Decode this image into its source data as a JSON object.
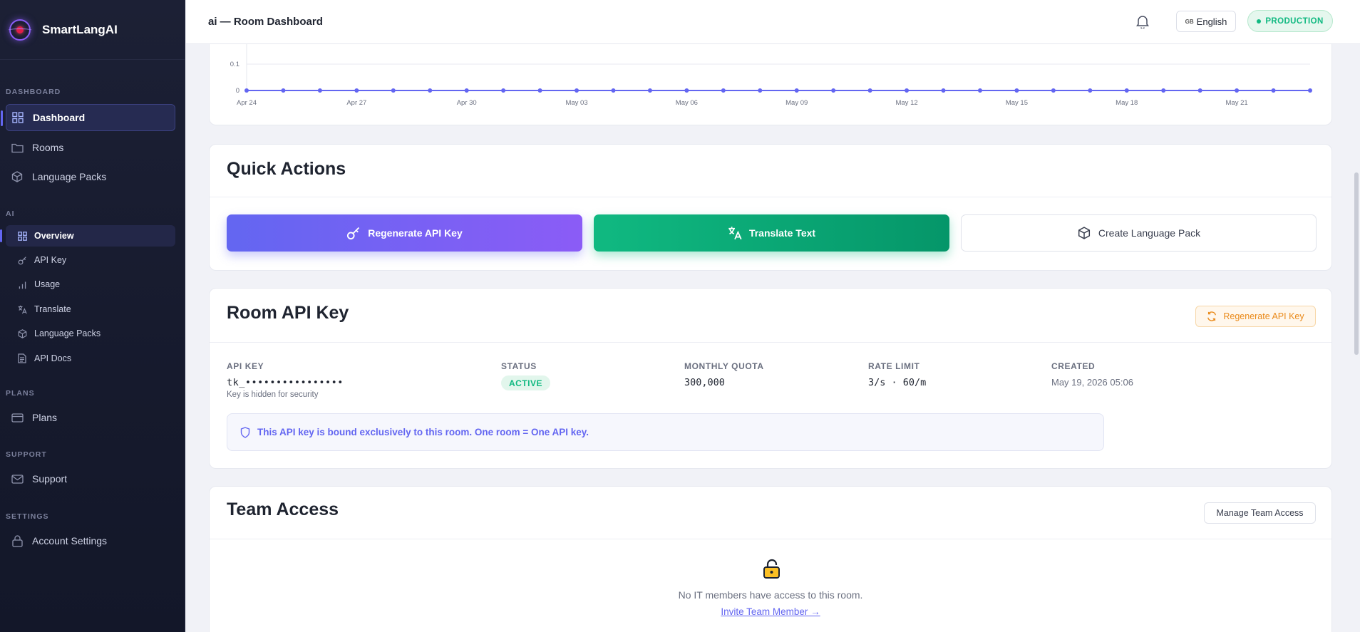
{
  "app": {
    "name": "SmartLangAI"
  },
  "sidebar": {
    "sections": {
      "dashboard": "DASHBOARD",
      "ai": "AI",
      "plans": "PLANS",
      "support": "SUPPORT",
      "settings": "SETTINGS"
    },
    "items": [
      {
        "label": "Dashboard",
        "icon": "grid-icon",
        "active": true
      },
      {
        "label": "Rooms",
        "icon": "folder-icon"
      },
      {
        "label": "Language Packs",
        "icon": "cube-icon"
      },
      {
        "label": "Overview",
        "icon": "grid-icon",
        "active": true
      },
      {
        "label": "API Key",
        "icon": "key-icon"
      },
      {
        "label": "Usage",
        "icon": "bar-chart-icon"
      },
      {
        "label": "Translate",
        "icon": "translate-icon"
      },
      {
        "label": "Language Packs",
        "icon": "cube-icon"
      },
      {
        "label": "API Docs",
        "icon": "document-icon"
      },
      {
        "label": "Plans",
        "icon": "credit-card-icon"
      },
      {
        "label": "Support",
        "icon": "mail-icon"
      },
      {
        "label": "Account Settings",
        "icon": "lock-icon"
      }
    ]
  },
  "topbar": {
    "title": "ai — Room Dashboard",
    "language": {
      "flag": "GB",
      "label": "English"
    },
    "environment": "PRODUCTION"
  },
  "chart_data": {
    "type": "line",
    "x": [
      "Apr 24",
      "Apr 25",
      "Apr 26",
      "Apr 27",
      "Apr 28",
      "Apr 29",
      "Apr 30",
      "May 01",
      "May 02",
      "May 03",
      "May 04",
      "May 05",
      "May 06",
      "May 07",
      "May 08",
      "May 09",
      "May 10",
      "May 11",
      "May 12",
      "May 13",
      "May 14",
      "May 15",
      "May 16",
      "May 17",
      "May 18",
      "May 19",
      "May 20",
      "May 21",
      "May 22",
      "May 23"
    ],
    "x_tick_labels": [
      "Apr 24",
      "Apr 27",
      "Apr 30",
      "May 03",
      "May 06",
      "May 09",
      "May 12",
      "May 15",
      "May 18",
      "May 21"
    ],
    "y_tick_labels": [
      "0.1",
      "0"
    ],
    "series": [
      {
        "values": [
          0,
          0,
          0,
          0,
          0,
          0,
          0,
          0,
          0,
          0,
          0,
          0,
          0,
          0,
          0,
          0,
          0,
          0,
          0,
          0,
          0,
          0,
          0,
          0,
          0,
          0,
          0,
          0,
          0,
          0
        ]
      }
    ],
    "colors": {
      "line": "#6366f1"
    }
  },
  "quick_actions": {
    "title": "Quick Actions",
    "regenerate": "Regenerate API Key",
    "translate": "Translate Text",
    "create_pack": "Create Language Pack"
  },
  "api_key": {
    "title": "Room API Key",
    "regenerate": "Regenerate API Key",
    "key_label": "API KEY",
    "key_value": "tk_••••••••••••••••",
    "key_hint": "Key is hidden for security",
    "status_label": "STATUS",
    "status_value": "ACTIVE",
    "quota_label": "MONTHLY QUOTA",
    "quota_value": "300,000",
    "rate_label": "RATE LIMIT",
    "rate_value": "3/s · 60/m",
    "created_label": "CREATED",
    "created_value": "May 19, 2026 05:06",
    "notice": "This API key is bound exclusively to this room. One room = One API key."
  },
  "team": {
    "title": "Team Access",
    "manage": "Manage Team Access",
    "empty": "No IT members have access to this room.",
    "invite": "Invite Team Member →"
  },
  "colors": {
    "accent": "#6366f1",
    "success": "#10b981",
    "warning": "#ea8a1a"
  }
}
